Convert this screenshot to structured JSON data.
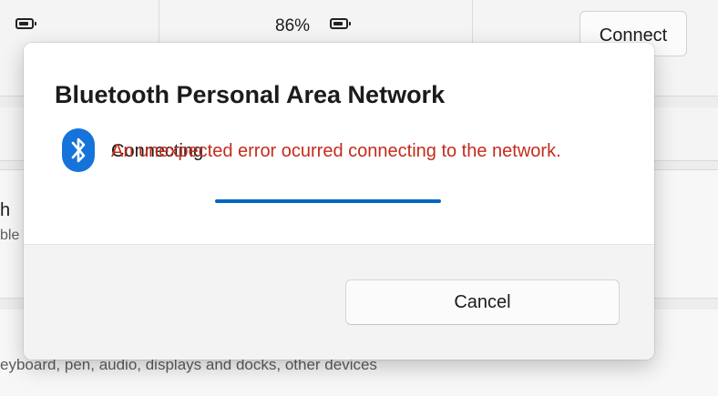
{
  "background": {
    "battery_percent": "86%",
    "connect_label": "Connect",
    "row_title_fragment": "h",
    "row_subtitle_fragment": "ble",
    "bottom_text": "eyboard, pen, audio, displays and docks, other devices"
  },
  "dialog": {
    "title": "Bluetooth Personal Area Network",
    "status": "Connecting",
    "error": "An unexpected error ocurred connecting to the network.",
    "cancel_label": "Cancel",
    "icon": "bluetooth-icon",
    "colors": {
      "error": "#c42b1c",
      "accent": "#0067c0",
      "icon_bg": "#1573d9"
    }
  }
}
